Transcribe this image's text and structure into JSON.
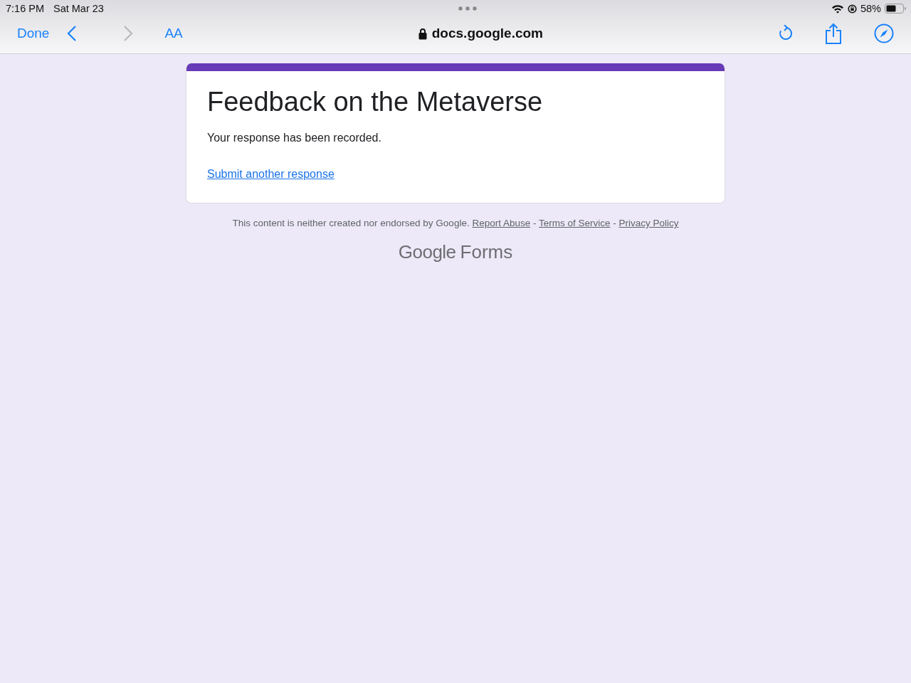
{
  "status_bar": {
    "time": "7:16 PM",
    "date": "Sat Mar 23",
    "battery": "58%"
  },
  "toolbar": {
    "done": "Done",
    "back_disabled": false,
    "forward_disabled": true,
    "text_size": "AA",
    "address": "docs.google.com"
  },
  "form": {
    "title": "Feedback on the Metaverse",
    "message": "Your response has been recorded.",
    "link": "Submit another response"
  },
  "footer": {
    "disclaimer": "This content is neither created nor endorsed by Google.",
    "links": [
      "Report Abuse",
      "Terms of Service",
      "Privacy Policy"
    ],
    "separator": "-",
    "logo_brand": "Google",
    "logo_product": "Forms"
  }
}
